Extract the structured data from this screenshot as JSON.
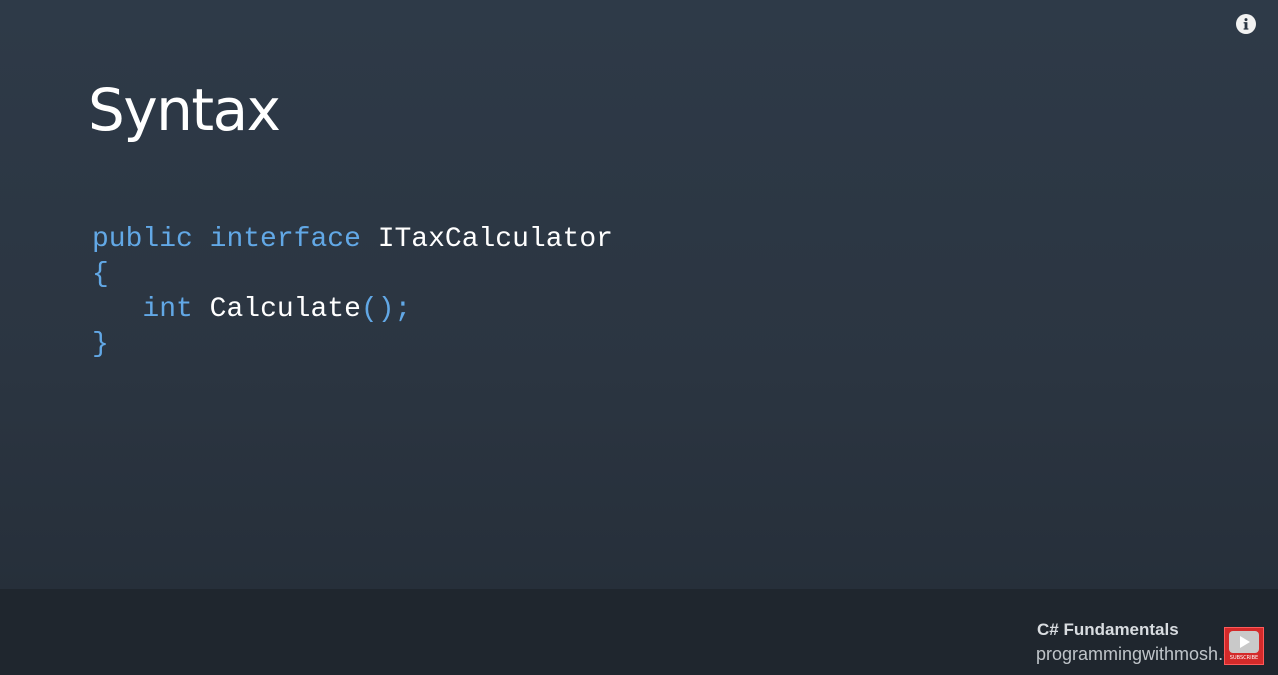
{
  "slide": {
    "title": "Syntax",
    "code": {
      "line1": {
        "kw1": "public",
        "kw2": "interface",
        "name": "ITaxCalculator"
      },
      "line2": {
        "brace": "{"
      },
      "line3": {
        "indent": "   ",
        "kw": "int",
        "name": "Calculate",
        "parens": "();"
      },
      "line4": {
        "brace": "}"
      }
    }
  },
  "overlay": {
    "info_icon": "info-icon"
  },
  "footer": {
    "course_title": "C# Fundamentals",
    "course_url": "programmingwithmosh.com",
    "subscribe_icon": "play-icon",
    "subscribe_label": "SUBSCRIBE"
  },
  "colors": {
    "background": "#2b3643",
    "keyword": "#62a8e6",
    "text": "#ffffff",
    "subscribe": "#d42a2a"
  }
}
